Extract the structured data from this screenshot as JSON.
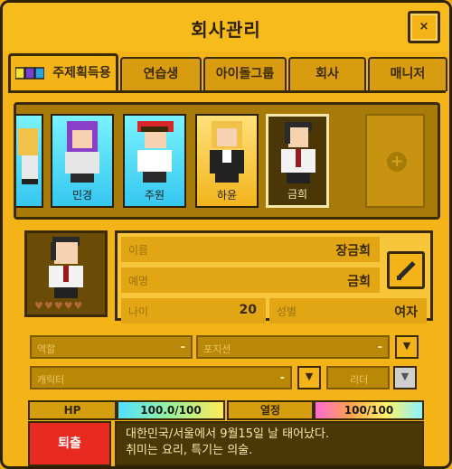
{
  "window": {
    "title": "회사관리",
    "close_label": "×"
  },
  "tabs": [
    {
      "label": "주제획득용"
    },
    {
      "label": "연습생"
    },
    {
      "label": "아이돌그룹"
    },
    {
      "label": "회사"
    },
    {
      "label": "매니저"
    }
  ],
  "characters": [
    {
      "name": "",
      "style": "cyan"
    },
    {
      "name": "민경",
      "style": "cyan"
    },
    {
      "name": "주원",
      "style": "cyan"
    },
    {
      "name": "하윤",
      "style": "gold"
    },
    {
      "name": "금희",
      "style": "dark"
    }
  ],
  "add_card": {
    "icon": "+"
  },
  "profile": {
    "hearts": "♥♥♥♥♥",
    "name_label": "이름",
    "name_value": "장금희",
    "stage_label": "예명",
    "stage_value": "금희",
    "age_label": "나이",
    "age_value": "20",
    "gender_label": "성별",
    "gender_value": "여자",
    "role_label": "역할",
    "role_value": "-",
    "position_label": "포지션",
    "position_value": "-",
    "character_label": "캐릭터",
    "character_value": "-",
    "leader_label": "리더",
    "hp_label": "HP",
    "hp_value": "100.0/100",
    "hp_fraction": 1.0,
    "passion_label": "열정",
    "passion_value": "100/100",
    "passion_fraction": 1.0,
    "leave_label": "퇴출",
    "bio_line1": "대한민국/서울에서 9월15일 날 태어났다.",
    "bio_line2": "취미는 요리, 특기는 의술."
  },
  "colors": {
    "accent": "#f4b418",
    "dark": "#3a2a06",
    "danger": "#e82a20"
  }
}
